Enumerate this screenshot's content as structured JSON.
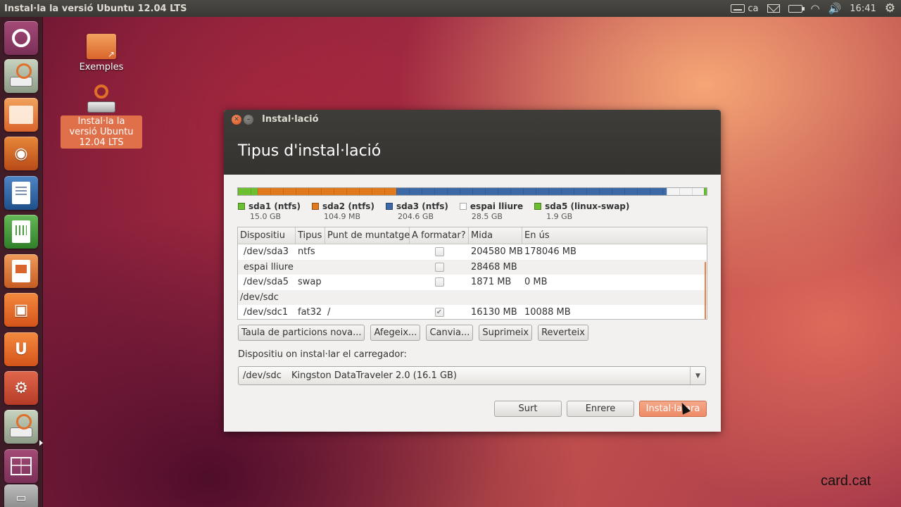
{
  "top_panel": {
    "title": "Instal·la la versió Ubuntu 12.04 LTS",
    "keyboard_layout": "ca",
    "clock": "16:41",
    "icons": [
      "keyboard-icon",
      "mail-icon",
      "battery-icon",
      "wifi-icon",
      "volume-icon",
      "gear-icon"
    ]
  },
  "launcher": {
    "items": [
      "ubuntu-dash",
      "installer",
      "files",
      "firefox",
      "writer",
      "calc",
      "impress",
      "software-center",
      "ubuntu-one",
      "system-settings",
      "installer-active",
      "workspace-switcher",
      "trash"
    ]
  },
  "desktop": {
    "icons": [
      {
        "label": "Exemples"
      },
      {
        "label": "Instal·la la versió Ubuntu 12.04 LTS"
      }
    ]
  },
  "dialog": {
    "window_title": "Instal·lació",
    "heading": "Tipus d'instal·lació",
    "partition_bar": {
      "segments": [
        {
          "name": "sda1",
          "size_gb": 15.0,
          "color": "#6bbf30"
        },
        {
          "name": "sda2",
          "size_gb": 104.9,
          "color": "#e07a1c"
        },
        {
          "name": "sda3",
          "size_gb": 204.6,
          "color": "#3d6aa6"
        },
        {
          "name": "espai lliure",
          "size_gb": 28.5,
          "color": "#f4f4f4"
        },
        {
          "name": "sda5",
          "size_gb": 1.9,
          "color": "#6bbf30"
        }
      ]
    },
    "legend": [
      {
        "label": "sda1 (ntfs)",
        "size": "15.0 GB",
        "color": "#6bbf30"
      },
      {
        "label": "sda2 (ntfs)",
        "size": "104.9 MB",
        "color": "#e07a1c"
      },
      {
        "label": "sda3 (ntfs)",
        "size": "204.6 GB",
        "color": "#3d6aa6"
      },
      {
        "label": "espai lliure",
        "size": "28.5 GB",
        "color": "#ffffff"
      },
      {
        "label": "sda5 (linux-swap)",
        "size": "1.9 GB",
        "color": "#6bbf30"
      }
    ],
    "table": {
      "headers": [
        "Dispositiu",
        "Tipus",
        "Punt de muntatge",
        "A formatar?",
        "Mida",
        "En ús"
      ],
      "rows": [
        {
          "device": "/dev/sda3",
          "type": "ntfs",
          "mount": "",
          "format": "unchecked",
          "size": "204580 MB",
          "used": "178046 MB"
        },
        {
          "device": "espai lliure",
          "type": "",
          "mount": "",
          "format": "unchecked",
          "size": "28468 MB",
          "used": ""
        },
        {
          "device": "/dev/sda5",
          "type": "swap",
          "mount": "",
          "format": "unchecked",
          "size": "1871 MB",
          "used": "0 MB"
        },
        {
          "device": "/dev/sdc",
          "type": "",
          "mount": "",
          "format": "none",
          "size": "",
          "used": ""
        },
        {
          "device": "/dev/sdc1",
          "type": "fat32",
          "mount": "/",
          "format": "checked",
          "size": "16130 MB",
          "used": "10088 MB"
        }
      ]
    },
    "buttons": {
      "new_table": "Taula de particions nova...",
      "add": "Afegeix...",
      "change": "Canvia...",
      "delete": "Suprimeix",
      "revert": "Reverteix"
    },
    "bootloader": {
      "label": "Dispositiu on instal·lar el carregador:",
      "device": "/dev/sdc",
      "description": "Kingston DataTraveler 2.0 (16.1 GB)"
    },
    "actions": {
      "quit": "Surt",
      "back": "Enrere",
      "install": "Instal·la ara"
    }
  },
  "watermark": "card.cat"
}
